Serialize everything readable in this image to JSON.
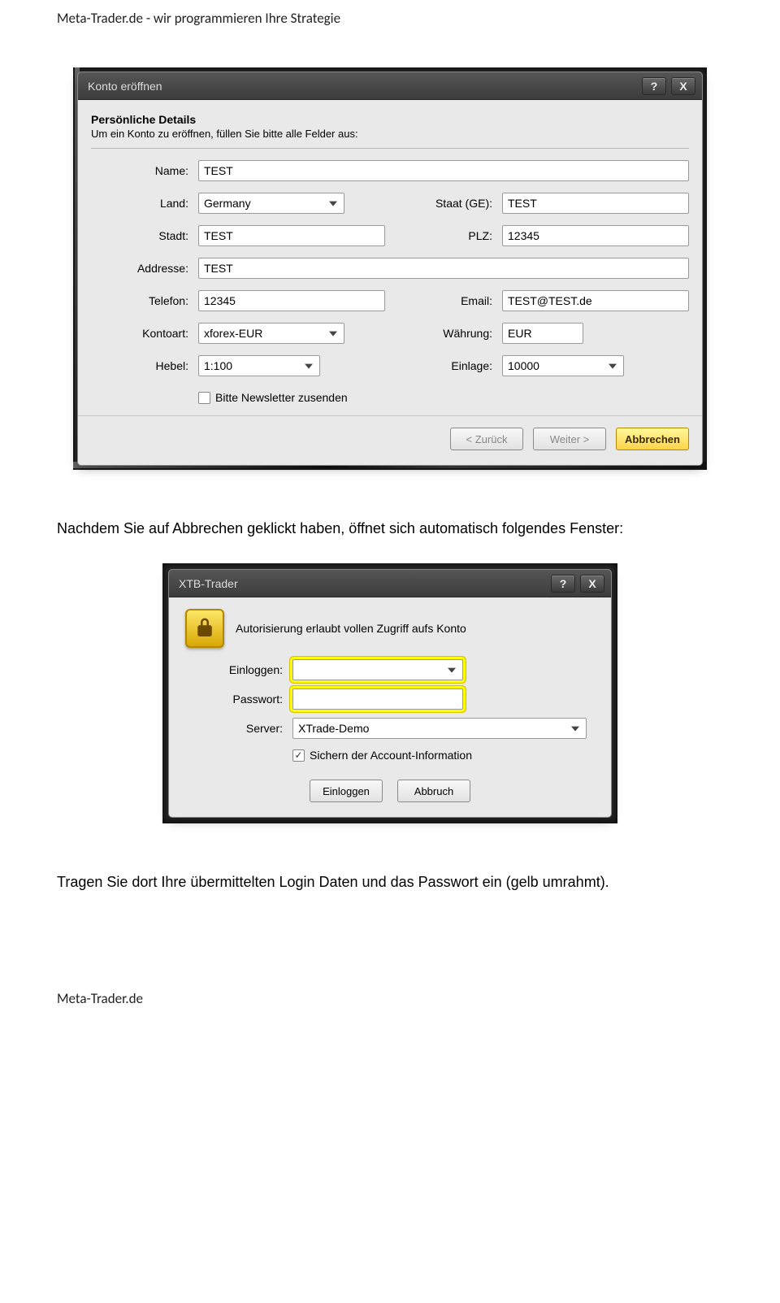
{
  "page": {
    "header": "Meta-Trader.de  -  wir programmieren Ihre Strategie",
    "footer": "Meta-Trader.de",
    "text_after_shot1": "Nachdem Sie auf Abbrechen geklickt haben, öffnet sich automatisch folgendes Fenster:",
    "text_after_shot2": "Tragen Sie dort Ihre übermittelten Login Daten und das Passwort ein (gelb umrahmt)."
  },
  "dialog1": {
    "title": "Konto eröffnen",
    "section_title": "Persönliche Details",
    "section_sub": "Um ein Konto zu eröffnen, füllen Sie bitte alle Felder aus:",
    "fields": {
      "name_label": "Name:",
      "name_value": "TEST",
      "land_label": "Land:",
      "land_value": "Germany",
      "staat_label": "Staat (GE):",
      "staat_value": "TEST",
      "stadt_label": "Stadt:",
      "stadt_value": "TEST",
      "plz_label": "PLZ:",
      "plz_value": "12345",
      "adresse_label": "Addresse:",
      "adresse_value": "TEST",
      "telefon_label": "Telefon:",
      "telefon_value": "12345",
      "email_label": "Email:",
      "email_value": "TEST@TEST.de",
      "kontoart_label": "Kontoart:",
      "kontoart_value": "xforex-EUR",
      "waehrung_label": "Währung:",
      "waehrung_value": "EUR",
      "hebel_label": "Hebel:",
      "hebel_value": "1:100",
      "einlage_label": "Einlage:",
      "einlage_value": "10000",
      "newsletter_label": "Bitte Newsletter zusenden"
    },
    "buttons": {
      "back": "< Zurück",
      "next": "Weiter >",
      "cancel": "Abbrechen"
    }
  },
  "dialog2": {
    "title": "XTB-Trader",
    "auth_text": "Autorisierung erlaubt vollen Zugriff aufs Konto",
    "fields": {
      "login_label": "Einloggen:",
      "login_value": "",
      "password_label": "Passwort:",
      "password_value": "",
      "server_label": "Server:",
      "server_value": "XTrade-Demo",
      "save_label": "Sichern der Account-Information"
    },
    "buttons": {
      "login": "Einloggen",
      "cancel": "Abbruch"
    }
  },
  "titlebar_buttons": {
    "help": "?",
    "close": "X"
  }
}
